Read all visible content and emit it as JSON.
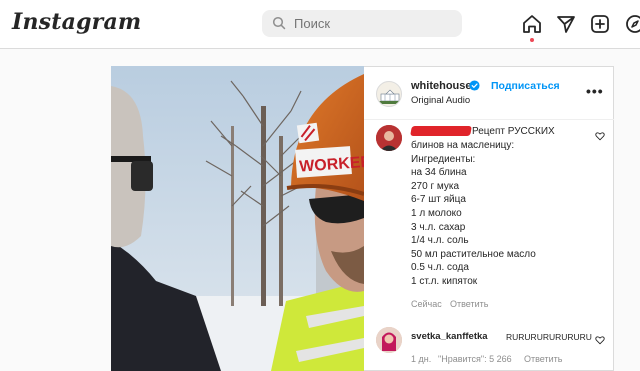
{
  "header": {
    "logo": "Instagram",
    "search_placeholder": "Поиск",
    "nav_icons": [
      "home-icon",
      "direct-icon",
      "create-icon",
      "explore-icon"
    ]
  },
  "post": {
    "author": "whitehouse",
    "verified": true,
    "follow_label": "Подписаться",
    "audio_label": "Original Audio",
    "helmet_text": "WORKER"
  },
  "comments": [
    {
      "username_redacted": true,
      "first_line": "Рецепт РУССКИХ",
      "lines": [
        "блинов на масленицу:",
        "Ингредиенты:",
        "на 34 блина",
        "270 г мука",
        "6-7 шт яйца",
        "1 л молоко",
        "3 ч.л. сахар",
        "1/4 ч.л. соль",
        "50 мл растительное масло",
        "0.5 ч.л. сода",
        "1 ст.л. кипяток"
      ],
      "time": "Сейчас",
      "reply_label": "Ответить"
    },
    {
      "username": "svetka_kanffetka",
      "text": "RURURURURURURU",
      "time": "1 дн.",
      "likes_label": "\"Нравится\": 5 266",
      "reply_label": "Ответить"
    }
  ],
  "colors": {
    "accent": "#0095f6",
    "verified": "#0095f6",
    "notification": "#ed4956",
    "redaction": "#e0242a"
  }
}
